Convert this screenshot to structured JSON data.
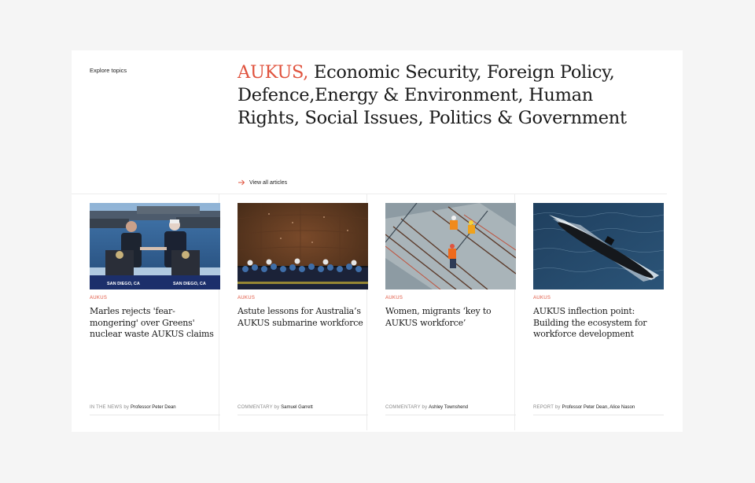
{
  "explore_label": "Explore topics",
  "topics": {
    "highlight": "AUKUS,",
    "rest": " Economic Security, Foreign Policy, Defence,Energy & Environment, Human Rights, Social Issues, Politics & Government"
  },
  "view_all": "View all articles",
  "articles": [
    {
      "tag": "AUKUS",
      "title": "Marles rejects 'fear-mongering' over Greens' nuclear waste AUKUS claims",
      "type": "IN THE NEWS",
      "by": "by",
      "author": "Professor Peter Dean",
      "image_caption_left": "SAN DIEGO, CA",
      "image_caption_right": "SAN DIEGO, CA"
    },
    {
      "tag": "AUKUS",
      "title": "Astute lessons for Australia’s AUKUS submarine workforce",
      "type": "COMMENTARY",
      "by": "by",
      "author": "Samuel Garrett"
    },
    {
      "tag": "AUKUS",
      "title": "Women, migrants ‘key to AUKUS workforce’",
      "type": "COMMENTARY",
      "by": "by",
      "author": "Ashley Townshend"
    },
    {
      "tag": "AUKUS",
      "title": "AUKUS inflection point: Building the ecosystem for workforce development",
      "type": "REPORT",
      "by": "by",
      "author": "Professor Peter Dean, Alice Nason"
    }
  ],
  "colors": {
    "accent": "#e0533e",
    "background": "#f5f5f5",
    "card": "#ffffff"
  },
  "icons": {
    "view_all": "arrow-right-icon"
  }
}
